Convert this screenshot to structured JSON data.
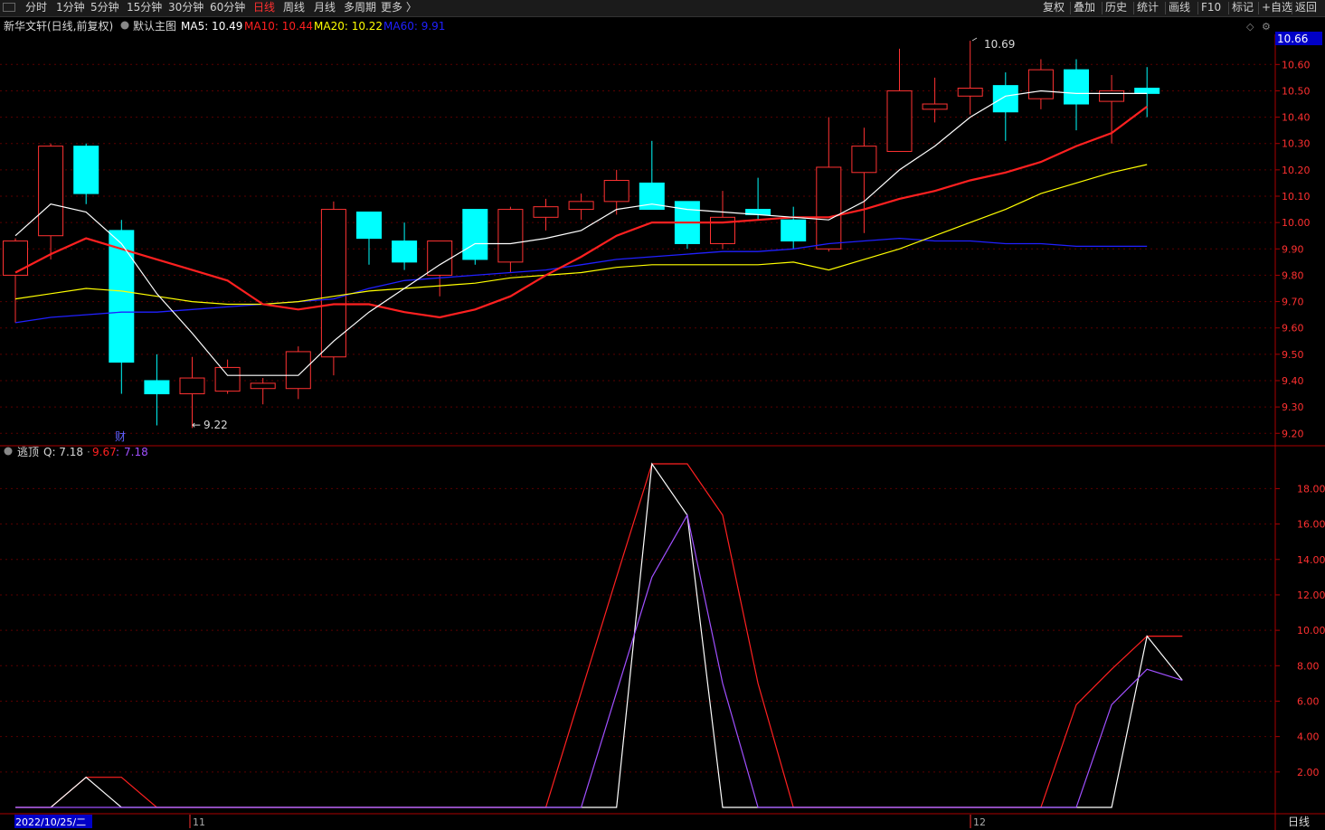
{
  "toolbar": {
    "left": [
      "分时",
      "1分钟",
      "5分钟",
      "15分钟",
      "30分钟",
      "60分钟",
      "日线",
      "周线",
      "月线",
      "多周期",
      "更多 〉"
    ],
    "active": "日线",
    "right": [
      "复权",
      "叠加",
      "历史",
      "统计",
      "画线",
      "F10",
      "标记",
      "+自选",
      "返回"
    ]
  },
  "main_info": {
    "stock": "新华文轩(日线,前复权)",
    "template": "默认主图",
    "ma5": "MA5: 10.49",
    "ma10": "MA10: 10.44",
    "ma20": "MA20: 10.22",
    "ma60": "MA60: 9.91",
    "price_tag": "10.66",
    "high_label": "10.69",
    "low_label": "9.22",
    "marker": "财"
  },
  "sub_info": {
    "name": "逃顶",
    "q": "Q: 7.18",
    "v1": "9.67",
    "v2": "7.18"
  },
  "axis": {
    "date_start": "2022/10/25/二",
    "month_11": "11",
    "month_12": "12",
    "period": "日线"
  },
  "colors": {
    "up": "#ff3232",
    "down": "#00ffff",
    "ma5": "#ffffff",
    "ma10": "#ff2020",
    "ma20": "#ffff00",
    "ma60": "#2020ff",
    "sub_red": "#ff2020",
    "sub_white": "#ffffff",
    "sub_purple": "#a050ff",
    "active_tab": "#ff3030"
  },
  "chart_data": [
    {
      "type": "candlestick",
      "ylim": [
        9.17,
        10.68
      ],
      "y_ticks": [
        9.2,
        9.3,
        9.4,
        9.5,
        9.6,
        9.7,
        9.8,
        9.9,
        10.0,
        10.1,
        10.2,
        10.3,
        10.4,
        10.5,
        10.6
      ],
      "candles": [
        {
          "o": 9.8,
          "h": 9.94,
          "l": 9.62,
          "c": 9.93
        },
        {
          "o": 9.95,
          "h": 10.3,
          "l": 9.86,
          "c": 10.29
        },
        {
          "o": 10.29,
          "h": 10.3,
          "l": 10.07,
          "c": 10.11
        },
        {
          "o": 9.97,
          "h": 10.01,
          "l": 9.35,
          "c": 9.47
        },
        {
          "o": 9.4,
          "h": 9.5,
          "l": 9.23,
          "c": 9.35
        },
        {
          "o": 9.35,
          "h": 9.49,
          "l": 9.22,
          "c": 9.41
        },
        {
          "o": 9.36,
          "h": 9.48,
          "l": 9.35,
          "c": 9.45
        },
        {
          "o": 9.37,
          "h": 9.41,
          "l": 9.31,
          "c": 9.39
        },
        {
          "o": 9.37,
          "h": 9.53,
          "l": 9.33,
          "c": 9.51
        },
        {
          "o": 9.49,
          "h": 10.08,
          "l": 9.42,
          "c": 10.05
        },
        {
          "o": 10.04,
          "h": 10.04,
          "l": 9.84,
          "c": 9.94
        },
        {
          "o": 9.93,
          "h": 10.0,
          "l": 9.82,
          "c": 9.85
        },
        {
          "o": 9.8,
          "h": 9.93,
          "l": 9.72,
          "c": 9.93
        },
        {
          "o": 10.05,
          "h": 10.05,
          "l": 9.84,
          "c": 9.86
        },
        {
          "o": 9.85,
          "h": 10.06,
          "l": 9.81,
          "c": 10.05
        },
        {
          "o": 10.02,
          "h": 10.09,
          "l": 9.97,
          "c": 10.06
        },
        {
          "o": 10.05,
          "h": 10.11,
          "l": 10.01,
          "c": 10.08
        },
        {
          "o": 10.08,
          "h": 10.2,
          "l": 10.03,
          "c": 10.16
        },
        {
          "o": 10.15,
          "h": 10.31,
          "l": 10.05,
          "c": 10.05
        },
        {
          "o": 10.08,
          "h": 10.08,
          "l": 9.9,
          "c": 9.92
        },
        {
          "o": 9.92,
          "h": 10.12,
          "l": 9.9,
          "c": 10.02
        },
        {
          "o": 10.05,
          "h": 10.17,
          "l": 10.01,
          "c": 10.03
        },
        {
          "o": 10.01,
          "h": 10.06,
          "l": 9.9,
          "c": 9.93
        },
        {
          "o": 9.9,
          "h": 10.4,
          "l": 9.89,
          "c": 10.21
        },
        {
          "o": 10.19,
          "h": 10.36,
          "l": 9.96,
          "c": 10.29
        },
        {
          "o": 10.27,
          "h": 10.66,
          "l": 10.27,
          "c": 10.5
        },
        {
          "o": 10.43,
          "h": 10.55,
          "l": 10.38,
          "c": 10.45
        },
        {
          "o": 10.48,
          "h": 10.69,
          "l": 10.41,
          "c": 10.51
        },
        {
          "o": 10.52,
          "h": 10.57,
          "l": 10.31,
          "c": 10.42
        },
        {
          "o": 10.47,
          "h": 10.62,
          "l": 10.43,
          "c": 10.58
        },
        {
          "o": 10.58,
          "h": 10.62,
          "l": 10.35,
          "c": 10.45
        },
        {
          "o": 10.46,
          "h": 10.56,
          "l": 10.3,
          "c": 10.5
        },
        {
          "o": 10.51,
          "h": 10.59,
          "l": 10.4,
          "c": 10.49
        }
      ],
      "ma5": [
        9.95,
        10.07,
        10.04,
        9.92,
        9.73,
        9.58,
        9.42,
        9.42,
        9.42,
        9.55,
        9.66,
        9.75,
        9.84,
        9.92,
        9.92,
        9.94,
        9.97,
        10.05,
        10.07,
        10.05,
        10.04,
        10.03,
        10.02,
        10.01,
        10.08,
        10.2,
        10.29,
        10.4,
        10.48,
        10.5,
        10.49,
        10.49,
        10.49
      ],
      "ma10": [
        9.81,
        9.88,
        9.94,
        9.9,
        9.86,
        9.82,
        9.78,
        9.69,
        9.67,
        9.69,
        9.69,
        9.66,
        9.64,
        9.67,
        9.72,
        9.8,
        9.87,
        9.95,
        10.0,
        10.0,
        10.0,
        10.01,
        10.02,
        10.02,
        10.05,
        10.09,
        10.12,
        10.16,
        10.19,
        10.23,
        10.29,
        10.34,
        10.44
      ],
      "ma20": [
        9.71,
        9.73,
        9.75,
        9.74,
        9.72,
        9.7,
        9.69,
        9.69,
        9.7,
        9.72,
        9.74,
        9.75,
        9.76,
        9.77,
        9.79,
        9.8,
        9.81,
        9.83,
        9.84,
        9.84,
        9.84,
        9.84,
        9.85,
        9.82,
        9.86,
        9.9,
        9.95,
        10.0,
        10.05,
        10.11,
        10.15,
        10.19,
        10.22
      ],
      "ma60": [
        9.62,
        9.64,
        9.65,
        9.66,
        9.66,
        9.67,
        9.68,
        9.69,
        9.7,
        9.71,
        9.75,
        9.78,
        9.79,
        9.8,
        9.81,
        9.82,
        9.84,
        9.86,
        9.87,
        9.88,
        9.89,
        9.89,
        9.9,
        9.92,
        9.93,
        9.94,
        9.93,
        9.93,
        9.92,
        9.92,
        9.91,
        9.91,
        9.91
      ]
    },
    {
      "type": "line",
      "ylim": [
        0,
        19.4
      ],
      "y_ticks": [
        2,
        4,
        6,
        8,
        10,
        12,
        14,
        16,
        18
      ],
      "series": [
        {
          "name": "",
          "color": "#ff2020",
          "values": [
            0,
            0,
            1.7,
            1.7,
            0,
            0,
            0,
            0,
            0,
            0,
            0,
            0,
            0,
            0,
            0,
            0,
            6.5,
            13,
            19.4,
            19.4,
            16.5,
            7,
            0,
            0,
            0,
            0,
            0,
            0,
            0,
            0,
            5.8,
            7.8,
            9.67,
            9.67
          ]
        },
        {
          "name": "",
          "color": "#ffffff",
          "values": [
            0,
            0,
            1.7,
            0,
            0,
            0,
            0,
            0,
            0,
            0,
            0,
            0,
            0,
            0,
            0,
            0,
            0,
            0,
            19.4,
            16.5,
            0,
            0,
            0,
            0,
            0,
            0,
            0,
            0,
            0,
            0,
            0,
            0,
            9.67,
            7.18
          ]
        },
        {
          "name": "",
          "color": "#a050ff",
          "values": [
            0,
            0,
            0,
            0,
            0,
            0,
            0,
            0,
            0,
            0,
            0,
            0,
            0,
            0,
            0,
            0,
            0,
            6.5,
            13,
            16.5,
            7,
            0,
            0,
            0,
            0,
            0,
            0,
            0,
            0,
            0,
            0,
            5.8,
            7.8,
            7.18
          ]
        }
      ]
    }
  ]
}
